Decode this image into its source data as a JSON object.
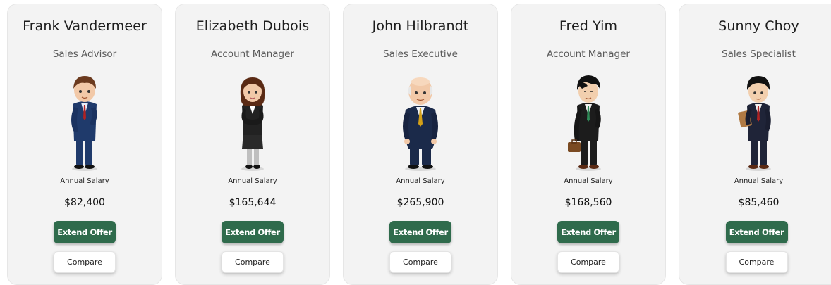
{
  "candidates": [
    {
      "name": "Frank Vandermeer",
      "title": "Sales Advisor",
      "salary_label": "Annual Salary",
      "salary": "$82,400",
      "offer_label": "Extend Offer",
      "compare_label": "Compare",
      "avatar": "avatar-brown-hair-blue-suit",
      "colors": {
        "hair": "#6b3a1e",
        "suit": "#1f3a6b",
        "tie": "#b22222",
        "shirt": "#e8eef8"
      }
    },
    {
      "name": "Elizabeth Dubois",
      "title": "Account Manager",
      "salary_label": "Annual Salary",
      "salary": "$165,644",
      "offer_label": "Extend Offer",
      "compare_label": "Compare",
      "avatar": "avatar-woman-black-suit",
      "colors": {
        "hair": "#5a2a14",
        "suit": "#222222",
        "tie": "#ffffff",
        "shirt": "#ffffff"
      }
    },
    {
      "name": "John Hilbrandt",
      "title": "Sales Executive",
      "salary_label": "Annual Salary",
      "salary": "$265,900",
      "offer_label": "Extend Offer",
      "compare_label": "Compare",
      "avatar": "avatar-bald-navy-suit",
      "colors": {
        "hair": "#e8b89a",
        "suit": "#1b2a4a",
        "tie": "#d4a017",
        "shirt": "#eef2f8"
      }
    },
    {
      "name": "Fred Yim",
      "title": "Account Manager",
      "salary_label": "Annual Salary",
      "salary": "$168,560",
      "offer_label": "Extend Offer",
      "compare_label": "Compare",
      "avatar": "avatar-black-hair-briefcase",
      "colors": {
        "hair": "#111111",
        "suit": "#1c1c1c",
        "tie": "#2e8b57",
        "shirt": "#f2f2f2"
      }
    },
    {
      "name": "Sunny Choy",
      "title": "Sales Specialist",
      "salary_label": "Annual Salary",
      "salary": "$85,460",
      "offer_label": "Extend Offer",
      "compare_label": "Compare",
      "avatar": "avatar-black-hair-folder",
      "colors": {
        "hair": "#111111",
        "suit": "#1f2438",
        "tie": "#b22222",
        "shirt": "#f2f2f2"
      }
    }
  ]
}
